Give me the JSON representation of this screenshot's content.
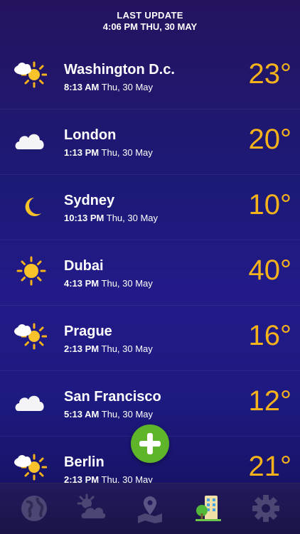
{
  "header": {
    "line1": "LAST UPDATE",
    "line2": "4:06 PM THU, 30 MAY"
  },
  "accent_temp_color": "#f6b21b",
  "cities": [
    {
      "name": "Washington D.c.",
      "time": "8:13 AM",
      "date": "Thu, 30 May",
      "temp": "23°",
      "icon": "partly-cloudy-icon"
    },
    {
      "name": "London",
      "time": "1:13 PM",
      "date": "Thu, 30 May",
      "temp": "20°",
      "icon": "cloud-icon"
    },
    {
      "name": "Sydney",
      "time": "10:13 PM",
      "date": "Thu, 30 May",
      "temp": "10°",
      "icon": "moon-icon"
    },
    {
      "name": "Dubai",
      "time": "4:13 PM",
      "date": "Thu, 30 May",
      "temp": "40°",
      "icon": "sun-icon"
    },
    {
      "name": "Prague",
      "time": "2:13 PM",
      "date": "Thu, 30 May",
      "temp": "16°",
      "icon": "partly-cloudy-icon"
    },
    {
      "name": "San Francisco",
      "time": "5:13 AM",
      "date": "Thu, 30 May",
      "temp": "12°",
      "icon": "cloud-icon"
    },
    {
      "name": "Berlin",
      "time": "2:13 PM",
      "date": "Thu, 30 May",
      "temp": "21°",
      "icon": "partly-cloudy-icon"
    }
  ],
  "tabs": [
    "globe-icon",
    "weather-icon",
    "map-pin-icon",
    "city-list-icon",
    "settings-gear-icon"
  ],
  "active_tab": "city-list-icon"
}
